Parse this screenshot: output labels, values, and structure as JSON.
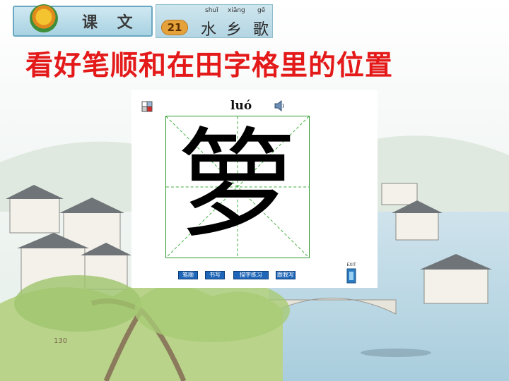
{
  "header": {
    "lesson_label": "课 文",
    "lesson_number": "21",
    "title_pinyin": [
      "shuǐ",
      "xiāng",
      "gē"
    ],
    "title_chars": [
      "水",
      "乡",
      "歌"
    ]
  },
  "main_heading": "看好笔顺和在田字格里的位置",
  "stroke_panel": {
    "pinyin": "luó",
    "character": "箩",
    "buttons": [
      "笔顺",
      "书写",
      "描字练习",
      "跟我写"
    ]
  },
  "exit_label": "EXIT",
  "page_number": "130",
  "colors": {
    "heading": "#e41a1a",
    "grid": "#2e9a2e",
    "button": "#1f66b8"
  }
}
